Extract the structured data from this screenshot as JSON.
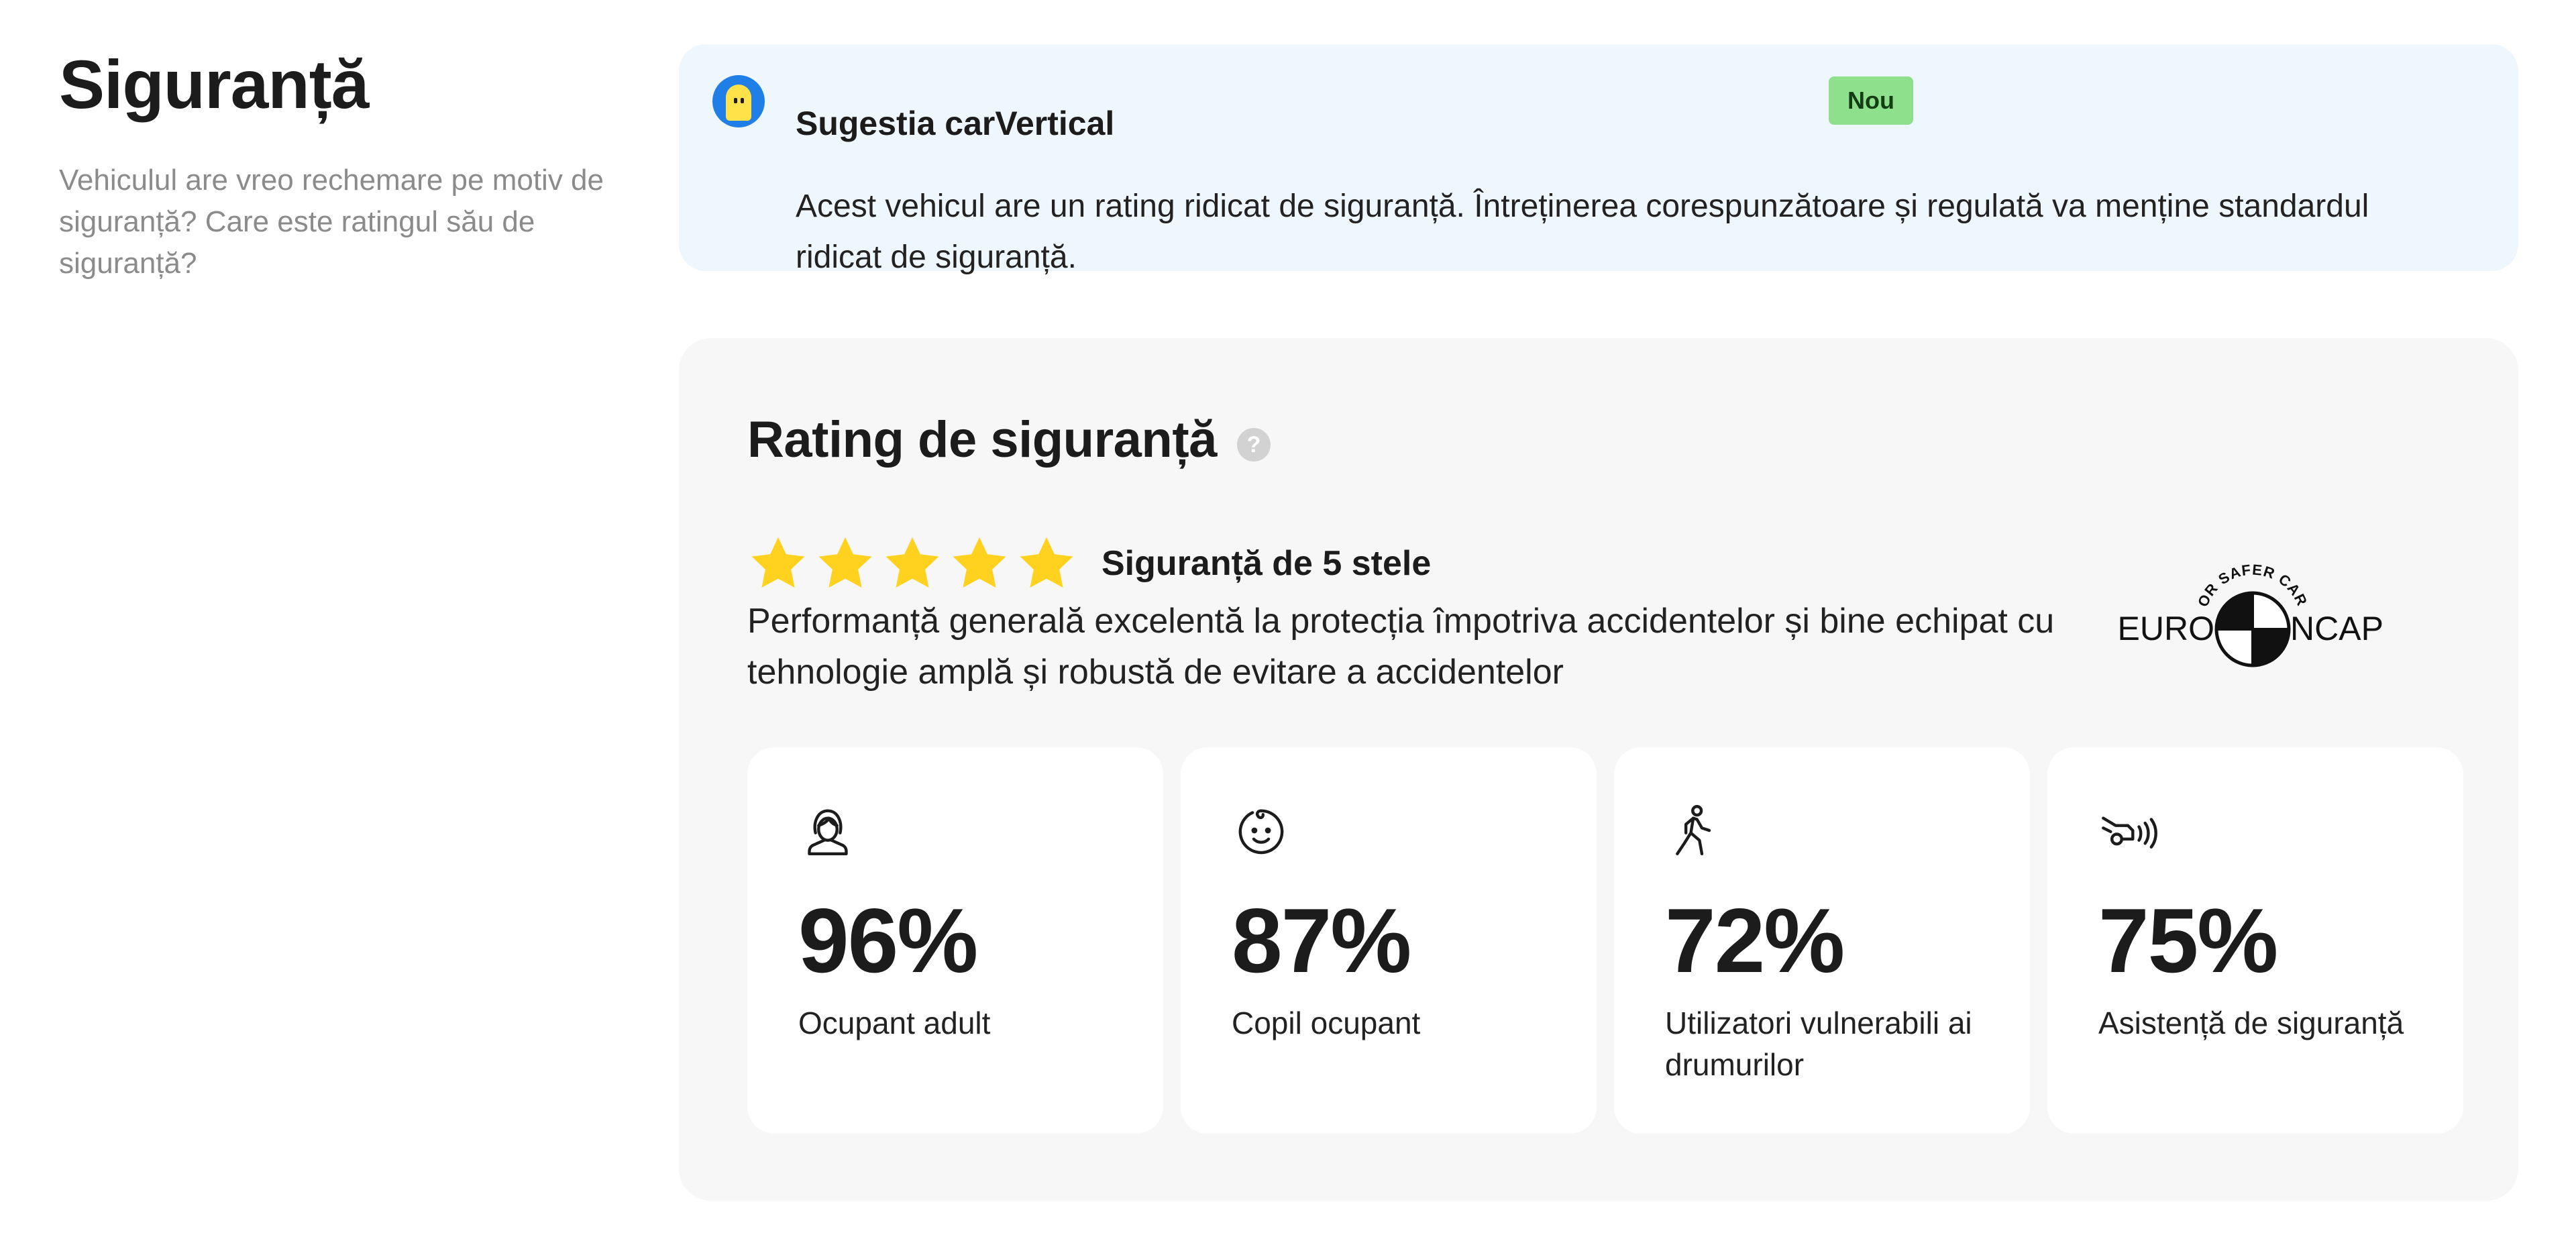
{
  "intro": {
    "title": "Siguranță",
    "description": "Vehiculul are vreo rechemare pe motiv de siguranță? Care este ratingul său de siguranță?"
  },
  "suggestion": {
    "title": "Sugestia carVertical",
    "badge": "Nou",
    "text": "Acest vehicul are un rating ridicat de siguranță. Întreținerea corespunzătoare și regulată va menține standardul ridicat de siguranță."
  },
  "rating": {
    "title": "Rating de siguranță",
    "help_glyph": "?",
    "stars": 5,
    "stars_max": 5,
    "stars_label": "Siguranță de 5 stele",
    "description": "Performanță generală excelentă la protecția împotriva accidentelor și bine echipat cu tehnologie amplă și robustă de evitare a accidentelor",
    "logo": {
      "top_text": "FOR SAFER CARS",
      "left_text": "EURO",
      "right_text": "NCAP"
    },
    "star_color": "#FFD21F",
    "cards": [
      {
        "icon": "adult-occupant-icon",
        "value": "96%",
        "label": "Ocupant adult"
      },
      {
        "icon": "child-occupant-icon",
        "value": "87%",
        "label": "Copil ocupant"
      },
      {
        "icon": "pedestrian-icon",
        "value": "72%",
        "label": "Utilizatori vulnerabili ai drumurilor"
      },
      {
        "icon": "safety-assist-icon",
        "value": "75%",
        "label": "Asistență de siguranță"
      }
    ]
  }
}
